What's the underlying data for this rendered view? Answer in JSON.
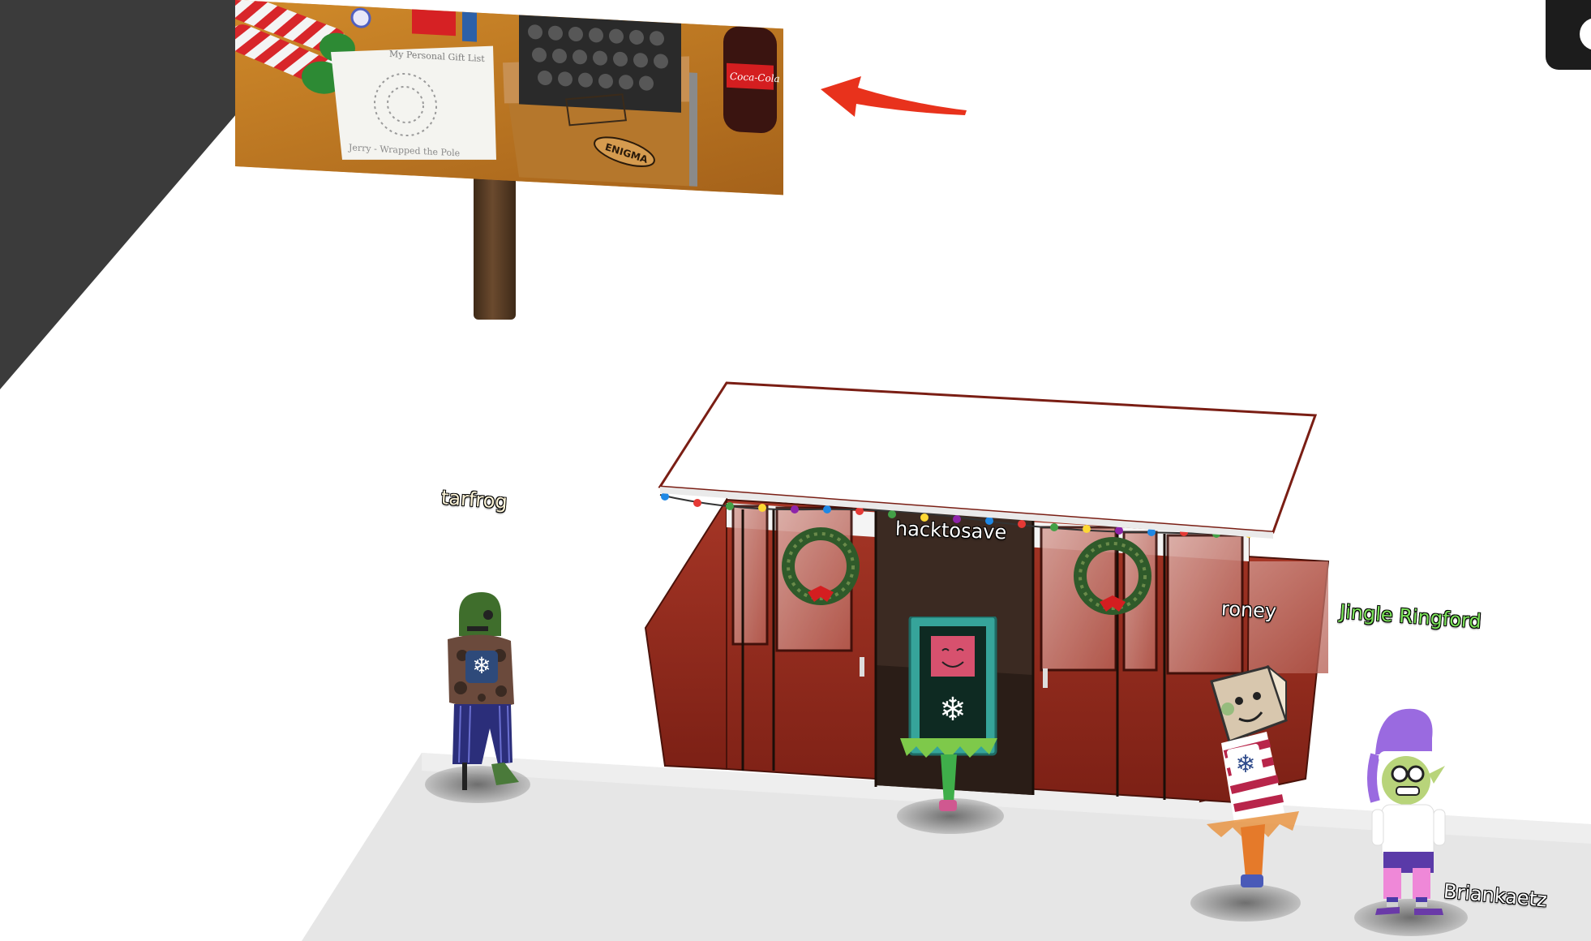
{
  "scene": {
    "background_color": "#ffffff",
    "floor_color": "#e8e8e8",
    "wall_color": "#3a3a3a"
  },
  "sign": {
    "photo_items": [
      "candy-cane-elf-legs",
      "wish-list-paper",
      "enigma-machine",
      "cola-bottle"
    ],
    "paper_text": "My Personal Gift List",
    "paper_footer": "Jerry - Wrapped the Pole",
    "enigma_label": "ENIGMA",
    "bottle_label": "Coca-Cola",
    "post_color": "#5a3d26"
  },
  "arrow": {
    "color": "#e8321c",
    "icon": "arrow-left-icon"
  },
  "tram": {
    "body_color": "#8e2a1c",
    "roof_color": "#ffffff",
    "wreath_count": 2,
    "lights": [
      "#e53935",
      "#43a047",
      "#1e88e5",
      "#fdd835",
      "#8e24aa"
    ]
  },
  "players": [
    {
      "name": "tarfrog",
      "style": "cream"
    },
    {
      "name": "hacktosave",
      "style": "white"
    },
    {
      "name": "roney",
      "style": "white"
    },
    {
      "name": "Jingle Ringford",
      "style": "green"
    },
    {
      "name": "Briankaetz",
      "style": "white"
    }
  ],
  "ui": {
    "top_right_icon": "menu-circle-icon",
    "top_right_color": "#1c1c1c"
  }
}
